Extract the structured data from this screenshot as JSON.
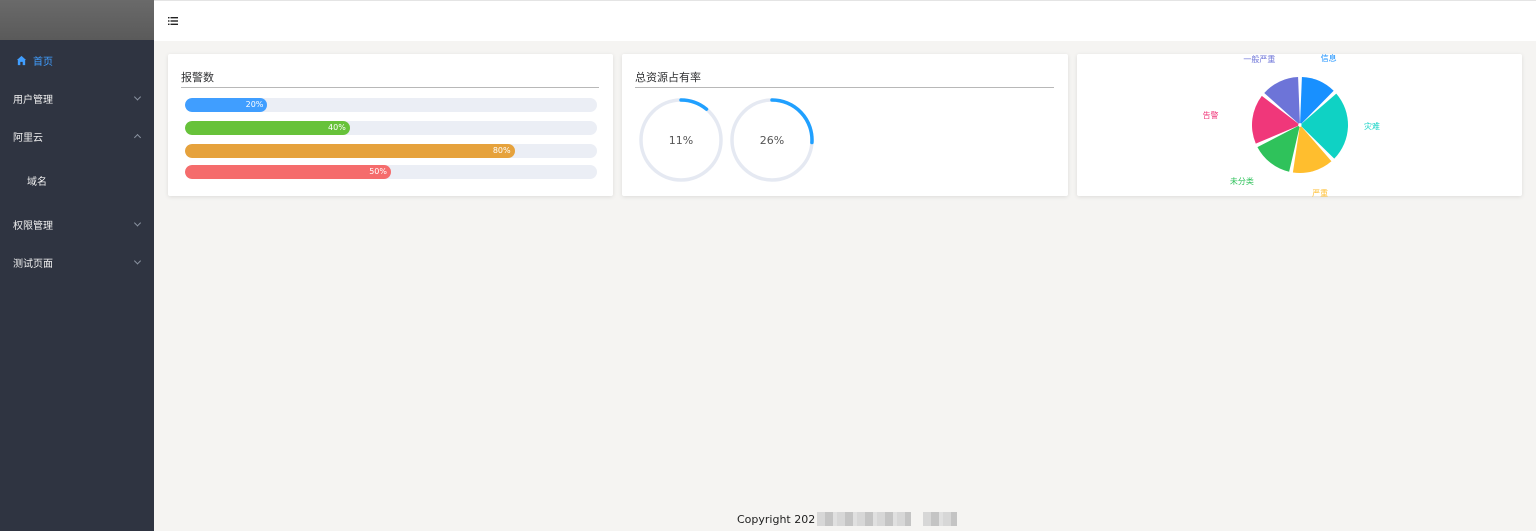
{
  "sidebar": {
    "items": [
      {
        "label": "首页",
        "active": true,
        "icon": "home-icon"
      },
      {
        "label": "用户管理",
        "icon": "chevron-down-icon"
      },
      {
        "label": "阿里云",
        "icon": "chevron-up-icon",
        "children": [
          {
            "label": "域名"
          }
        ]
      },
      {
        "label": "权限管理",
        "icon": "chevron-down-icon"
      },
      {
        "label": "测试页面",
        "icon": "chevron-down-icon"
      }
    ]
  },
  "header": {
    "toggle_icon": "menu-fold-icon"
  },
  "alarms": {
    "title": "报警数",
    "bars": [
      {
        "percent": 20,
        "label": "20%",
        "color": "#409eff"
      },
      {
        "percent": 40,
        "label": "40%",
        "color": "#67c23a"
      },
      {
        "percent": 80,
        "label": "80%",
        "color": "#e6a23c"
      },
      {
        "percent": 50,
        "label": "50%",
        "color": "#f56c6c"
      }
    ]
  },
  "resources": {
    "title": "总资源占有率",
    "rings": [
      {
        "percent": 11,
        "label": "11%",
        "color": "#20a0ff"
      },
      {
        "percent": 26,
        "label": "26%",
        "color": "#20a0ff"
      }
    ]
  },
  "chart_data": {
    "type": "pie",
    "categories": [
      "信息",
      "灾难",
      "严重",
      "未分类",
      "告警",
      "一般严重"
    ],
    "values": [
      13,
      25,
      15,
      15,
      18,
      14
    ],
    "colors": [
      "#1890ff",
      "#0fd2c4",
      "#ffbe2e",
      "#2fc25b",
      "#f0377a",
      "#6d74d8"
    ]
  },
  "footer": {
    "text": "Copyright 202"
  }
}
